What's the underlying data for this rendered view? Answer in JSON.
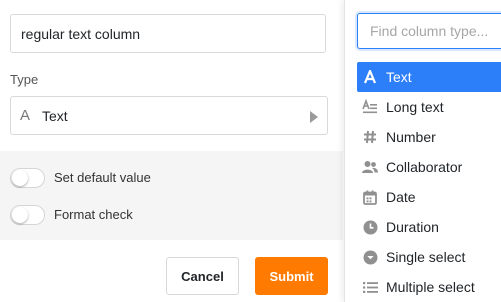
{
  "form": {
    "name_value": "regular text column",
    "type_label": "Type",
    "type_select": {
      "icon": "text-a-icon",
      "glyph": "A",
      "value": "Text"
    },
    "toggles": [
      {
        "label": "Set default value",
        "on": false
      },
      {
        "label": "Format check",
        "on": false
      }
    ],
    "cancel_label": "Cancel",
    "submit_label": "Submit"
  },
  "dropdown": {
    "search_placeholder": "Find column type...",
    "items": [
      {
        "label": "Text",
        "icon": "text-a-icon",
        "selected": true
      },
      {
        "label": "Long text",
        "icon": "long-text-icon",
        "selected": false
      },
      {
        "label": "Number",
        "icon": "hash-icon",
        "selected": false
      },
      {
        "label": "Collaborator",
        "icon": "people-icon",
        "selected": false
      },
      {
        "label": "Date",
        "icon": "calendar-icon",
        "selected": false
      },
      {
        "label": "Duration",
        "icon": "clock-icon",
        "selected": false
      },
      {
        "label": "Single select",
        "icon": "chevron-circle-icon",
        "selected": false
      },
      {
        "label": "Multiple select",
        "icon": "list-icon",
        "selected": false
      }
    ]
  },
  "colors": {
    "accent": "#2d7ff9",
    "submit": "#ff7a00",
    "options_bg": "#f5f5f5"
  }
}
